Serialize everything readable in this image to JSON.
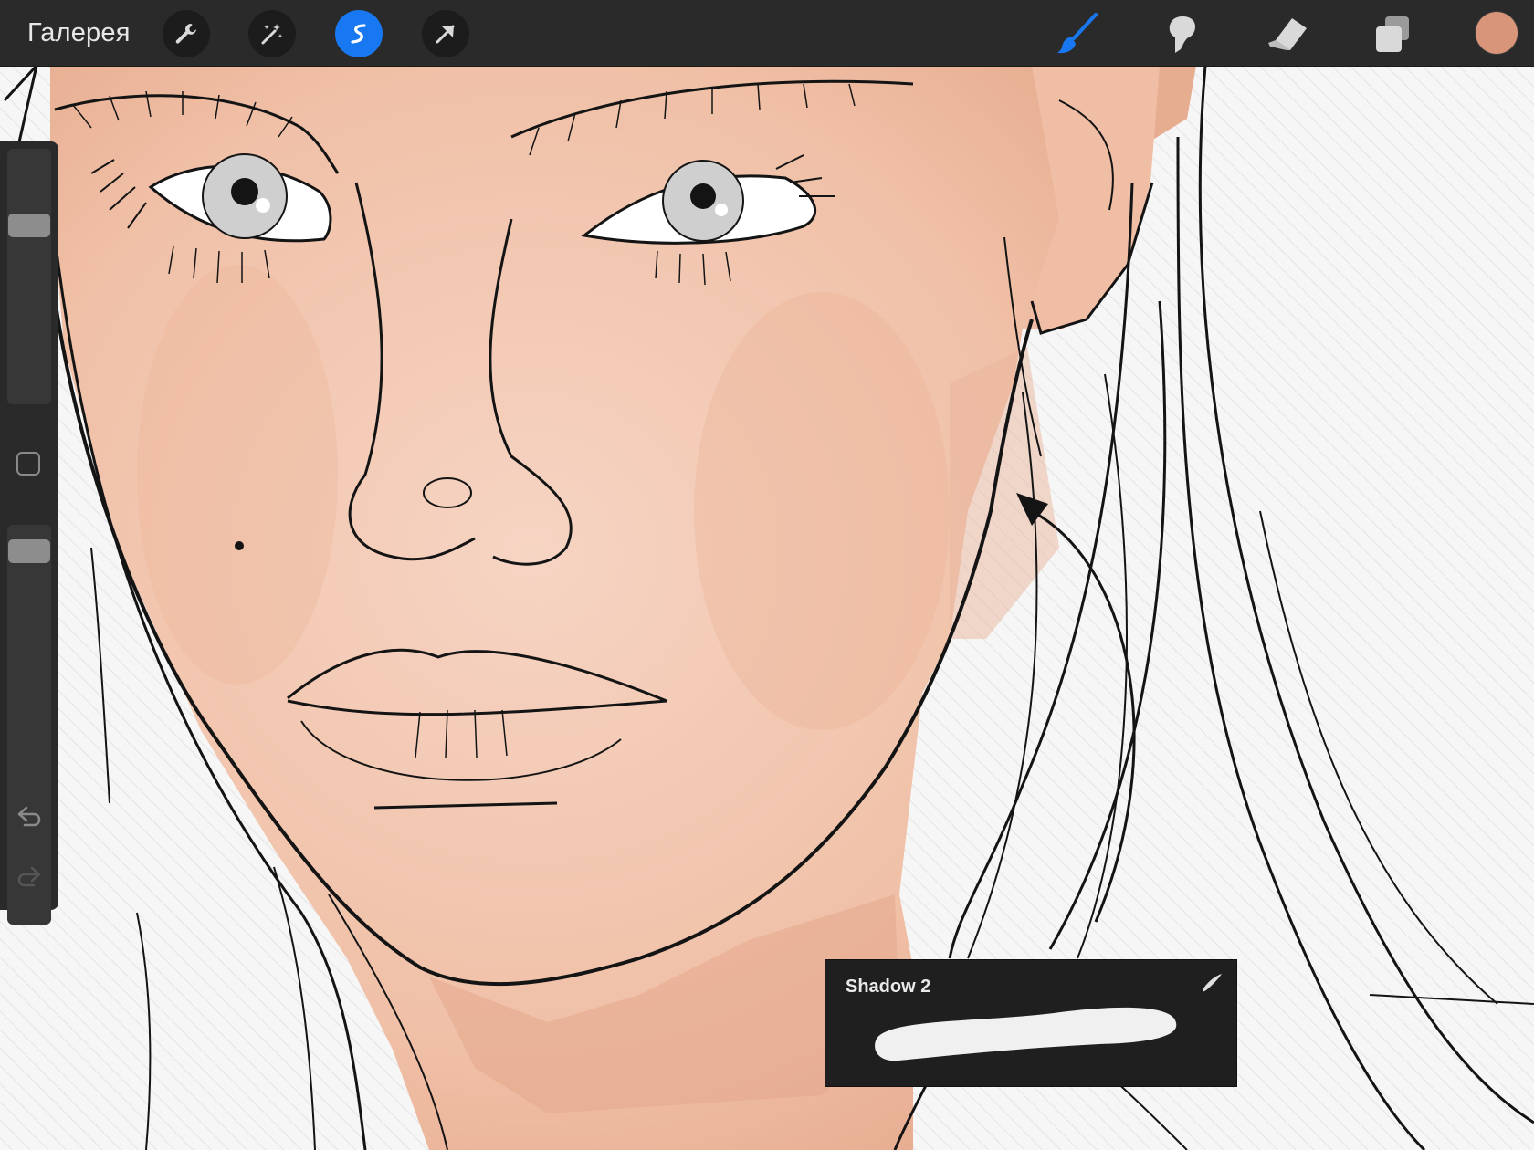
{
  "toolbar": {
    "gallery_label": "Галерея",
    "left_tools": [
      {
        "name": "actions-wrench-icon",
        "active": false
      },
      {
        "name": "adjustments-magic-wand-icon",
        "active": false
      },
      {
        "name": "selection-icon",
        "active": true
      },
      {
        "name": "transform-arrow-icon",
        "active": false
      }
    ],
    "right_tools": [
      "brush-icon",
      "smudge-icon",
      "eraser-icon",
      "layers-icon"
    ],
    "current_color": "#d8957a",
    "accent_color": "#1778f2"
  },
  "sidebar": {
    "brush_size_level": 0.28,
    "opacity_level": 0.04,
    "undo_icon": "undo-arrow-icon",
    "redo_icon": "redo-arrow-icon"
  },
  "brush_popup": {
    "brush_name": "Shadow 2",
    "pen_icon": "stylus-pressure-icon"
  },
  "canvas": {
    "skin_color": "#f2c4ad",
    "shadow_color": "#dc9f83",
    "line_color": "#141414",
    "background_color": "#f4f4f4"
  }
}
